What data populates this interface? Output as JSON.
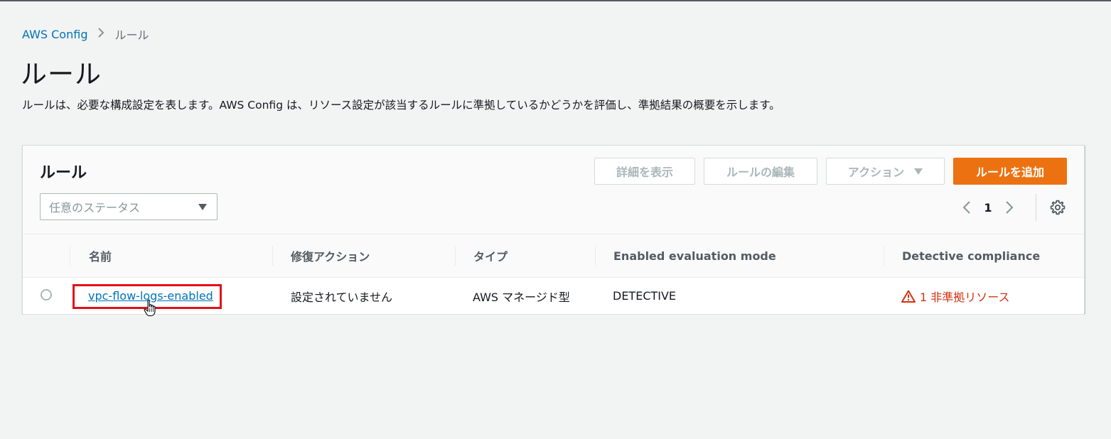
{
  "breadcrumb": {
    "root": "AWS Config",
    "current": "ルール"
  },
  "page": {
    "title": "ルール",
    "description": "ルールは、必要な構成設定を表します。AWS Config は、リソース設定が該当するルールに準拠しているかどうかを評価し、準拠結果の概要を示します。"
  },
  "panel": {
    "title": "ルール",
    "filter_placeholder": "任意のステータス",
    "buttons": {
      "details": "詳細を表示",
      "edit": "ルールの編集",
      "actions": "アクション",
      "add": "ルールを追加"
    },
    "pagination": {
      "current_page": "1"
    }
  },
  "table": {
    "columns": {
      "name": "名前",
      "remediation": "修復アクション",
      "type": "タイプ",
      "evaluation_mode": "Enabled evaluation mode",
      "compliance": "Detective compliance"
    },
    "rows": [
      {
        "name": "vpc-flow-logs-enabled",
        "remediation": "設定されていません",
        "type": "AWS マネージド型",
        "evaluation_mode": "DETECTIVE",
        "compliance": "1 非準拠リソース"
      }
    ]
  },
  "colors": {
    "link": "#0073bb",
    "primary_button": "#ec7211",
    "noncompliant": "#d13212",
    "highlight": "#e0101a"
  },
  "icons": {
    "breadcrumb_separator": "chevron-right-icon",
    "filter_dropdown": "caret-down-icon",
    "actions_dropdown": "caret-down-icon",
    "previous_page": "chevron-left-icon",
    "next_page": "chevron-right-icon",
    "preferences": "gear-icon",
    "noncompliant": "warning-icon",
    "cursor": "hand-pointer-icon"
  }
}
